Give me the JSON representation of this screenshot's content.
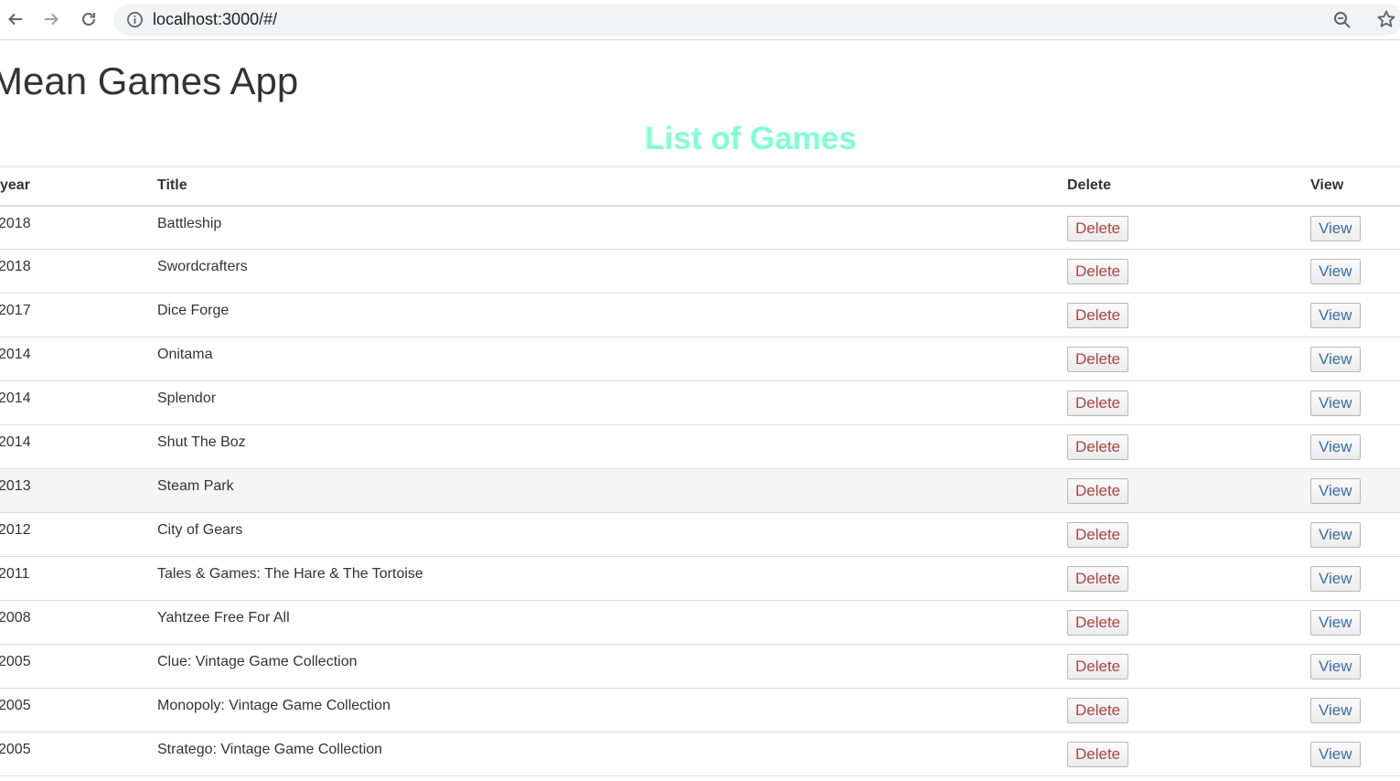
{
  "browser": {
    "url": "localhost:3000/#/",
    "icons": {
      "back": "back-arrow-icon",
      "forward": "forward-arrow-icon",
      "reload": "reload-icon",
      "info": "info-icon",
      "zoom": "zoom-icon",
      "bookmark": "star-icon"
    }
  },
  "page": {
    "app_title": "Mean Games App",
    "list_title": "List of Games",
    "accent_color": "#7fffd4"
  },
  "table": {
    "headers": {
      "year": "year",
      "title": "Title",
      "delete": "Delete",
      "view": "View"
    },
    "delete_label": "Delete",
    "view_label": "View",
    "rows": [
      {
        "year": "2018",
        "title": "Battleship"
      },
      {
        "year": "2018",
        "title": "Swordcrafters"
      },
      {
        "year": "2017",
        "title": "Dice Forge"
      },
      {
        "year": "2014",
        "title": "Onitama"
      },
      {
        "year": "2014",
        "title": "Splendor"
      },
      {
        "year": "2014",
        "title": "Shut The Boz"
      },
      {
        "year": "2013",
        "title": "Steam Park"
      },
      {
        "year": "2012",
        "title": "City of Gears"
      },
      {
        "year": "2011",
        "title": "Tales & Games: The Hare & The Tortoise"
      },
      {
        "year": "2008",
        "title": "Yahtzee Free For All"
      },
      {
        "year": "2005",
        "title": "Clue: Vintage Game Collection"
      },
      {
        "year": "2005",
        "title": "Monopoly: Vintage Game Collection"
      },
      {
        "year": "2005",
        "title": "Stratego: Vintage Game Collection"
      }
    ]
  }
}
